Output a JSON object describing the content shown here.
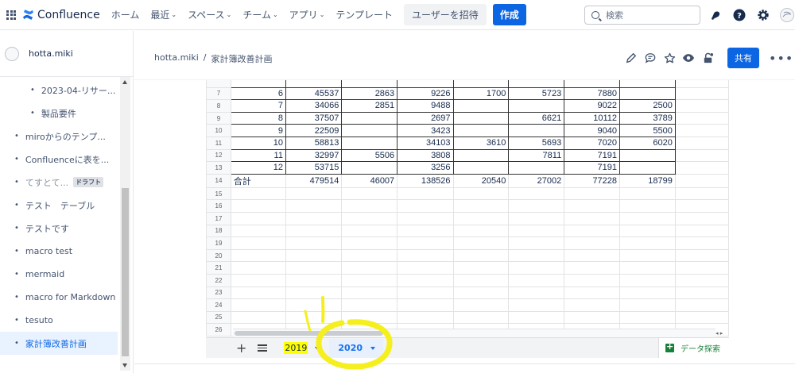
{
  "topnav": {
    "brand": "Confluence",
    "items": [
      {
        "label": "ホーム",
        "dropdown": false
      },
      {
        "label": "最近",
        "dropdown": true
      },
      {
        "label": "スペース",
        "dropdown": true
      },
      {
        "label": "チーム",
        "dropdown": true
      },
      {
        "label": "アプリ",
        "dropdown": true
      },
      {
        "label": "テンプレート",
        "dropdown": false
      }
    ],
    "invite_label": "ユーザーを招待",
    "create_label": "作成",
    "search_placeholder": "検索"
  },
  "sidebar": {
    "space_name": "hotta.miki",
    "items": [
      {
        "label": "2023-04-リサー...",
        "level": 2
      },
      {
        "label": "製品要件",
        "level": 2
      },
      {
        "label": "miroからのテンプ...",
        "level": 1
      },
      {
        "label": "Confluenceに表を...",
        "level": 1
      },
      {
        "label": "てすとて...",
        "level": 1,
        "tag": "ドラフト",
        "muted": true
      },
      {
        "label": "テスト　テーブル",
        "level": 1
      },
      {
        "label": "テストです",
        "level": 1
      },
      {
        "label": "macro test",
        "level": 1
      },
      {
        "label": "mermaid",
        "level": 1
      },
      {
        "label": "macro for Markdown",
        "level": 1
      },
      {
        "label": "tesuto",
        "level": 1
      },
      {
        "label": "家計簿改善計画",
        "level": 1,
        "active": true
      }
    ]
  },
  "breadcrumb": {
    "space": "hotta.miki",
    "separator": "/",
    "page": "家計簿改善計画"
  },
  "page_actions": {
    "share_label": "共有"
  },
  "sheet": {
    "top_partial_row": {
      "num": "6",
      "cells": [
        "",
        "",
        "",
        "",
        "",
        "",
        "",
        "",
        ""
      ]
    },
    "rows": [
      {
        "num": "7",
        "cells": [
          "6",
          "45537",
          "2863",
          "9226",
          "1700",
          "5723",
          "7880",
          "",
          ""
        ]
      },
      {
        "num": "8",
        "cells": [
          "7",
          "34066",
          "2851",
          "9488",
          "",
          "",
          "9022",
          "2500",
          ""
        ]
      },
      {
        "num": "9",
        "cells": [
          "8",
          "37507",
          "",
          "2697",
          "",
          "6621",
          "10112",
          "3789",
          ""
        ]
      },
      {
        "num": "10",
        "cells": [
          "9",
          "22509",
          "",
          "3423",
          "",
          "",
          "9040",
          "5500",
          ""
        ]
      },
      {
        "num": "11",
        "cells": [
          "10",
          "58813",
          "",
          "34103",
          "3610",
          "5693",
          "7020",
          "6020",
          ""
        ]
      },
      {
        "num": "12",
        "cells": [
          "11",
          "32997",
          "5506",
          "3808",
          "",
          "7811",
          "7191",
          "",
          ""
        ]
      },
      {
        "num": "13",
        "cells": [
          "12",
          "53715",
          "",
          "3256",
          "",
          "",
          "7191",
          "",
          ""
        ]
      },
      {
        "num": "14",
        "cells": [
          "合計",
          "479514",
          "46007",
          "138526",
          "20540",
          "27002",
          "77228",
          "18799",
          ""
        ]
      },
      {
        "num": "15",
        "cells": [
          "",
          "",
          "",
          "",
          "",
          "",
          "",
          "",
          ""
        ]
      },
      {
        "num": "16",
        "cells": [
          "",
          "",
          "",
          "",
          "",
          "",
          "",
          "",
          ""
        ]
      },
      {
        "num": "17",
        "cells": [
          "",
          "",
          "",
          "",
          "",
          "",
          "",
          "",
          ""
        ]
      },
      {
        "num": "18",
        "cells": [
          "",
          "",
          "",
          "",
          "",
          "",
          "",
          "",
          ""
        ]
      },
      {
        "num": "19",
        "cells": [
          "",
          "",
          "",
          "",
          "",
          "",
          "",
          "",
          ""
        ]
      },
      {
        "num": "20",
        "cells": [
          "",
          "",
          "",
          "",
          "",
          "",
          "",
          "",
          ""
        ]
      },
      {
        "num": "21",
        "cells": [
          "",
          "",
          "",
          "",
          "",
          "",
          "",
          "",
          ""
        ]
      },
      {
        "num": "22",
        "cells": [
          "",
          "",
          "",
          "",
          "",
          "",
          "",
          "",
          ""
        ]
      },
      {
        "num": "23",
        "cells": [
          "",
          "",
          "",
          "",
          "",
          "",
          "",
          "",
          ""
        ]
      },
      {
        "num": "24",
        "cells": [
          "",
          "",
          "",
          "",
          "",
          "",
          "",
          "",
          ""
        ]
      },
      {
        "num": "25",
        "cells": [
          "",
          "",
          "",
          "",
          "",
          "",
          "",
          "",
          ""
        ]
      },
      {
        "num": "26",
        "cells": [
          "",
          "",
          "",
          "",
          "",
          "",
          "",
          "",
          ""
        ]
      }
    ]
  },
  "tabs": [
    {
      "label": "2019",
      "highlighted": true,
      "active": false
    },
    {
      "label": "2020",
      "highlighted": false,
      "active": true
    }
  ],
  "explore_label": "データ探索",
  "colors": {
    "accent": "#0c66e4",
    "highlight": "#ffff00",
    "annotation": "#f5ef1d",
    "explore": "#188038"
  },
  "icons": [
    "apps-grid-icon",
    "confluence-logo-icon",
    "search-icon",
    "notification-icon",
    "help-icon",
    "settings-icon",
    "profile-avatar-icon",
    "edit-icon",
    "comment-icon",
    "star-icon",
    "watch-icon",
    "restrictions-icon",
    "more-icon"
  ]
}
